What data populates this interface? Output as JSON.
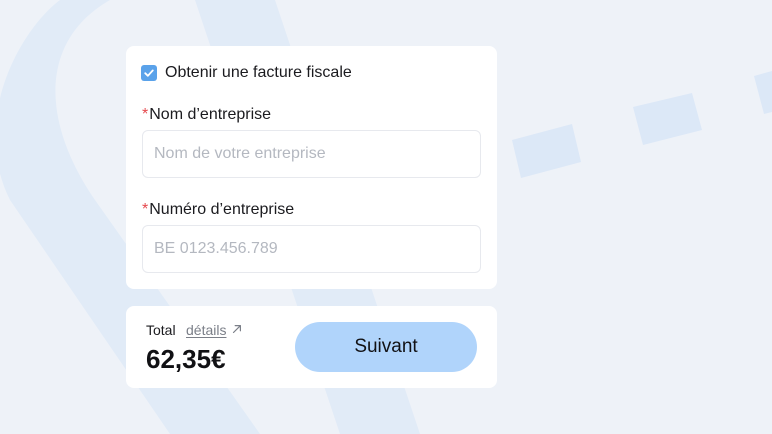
{
  "invoice": {
    "checkbox_label": "Obtenir une facture fiscale",
    "checked": true
  },
  "company_name": {
    "required_mark": "*",
    "label": "Nom d’entreprise",
    "placeholder": "Nom de votre entreprise",
    "value": ""
  },
  "company_number": {
    "required_mark": "*",
    "label": "Numéro d’entreprise",
    "placeholder": "BE 0123.456.789",
    "value": ""
  },
  "summary": {
    "total_label": "Total",
    "details_link": "détails",
    "details_icon": "arrow-up-right-icon",
    "amount": "62,35€",
    "next_button": "Suivant"
  },
  "colors": {
    "background": "#eef2f8",
    "decor": "#dce8f7",
    "checkbox": "#5aa2ea",
    "required": "#e5484d",
    "button": "#b0d4fb"
  }
}
